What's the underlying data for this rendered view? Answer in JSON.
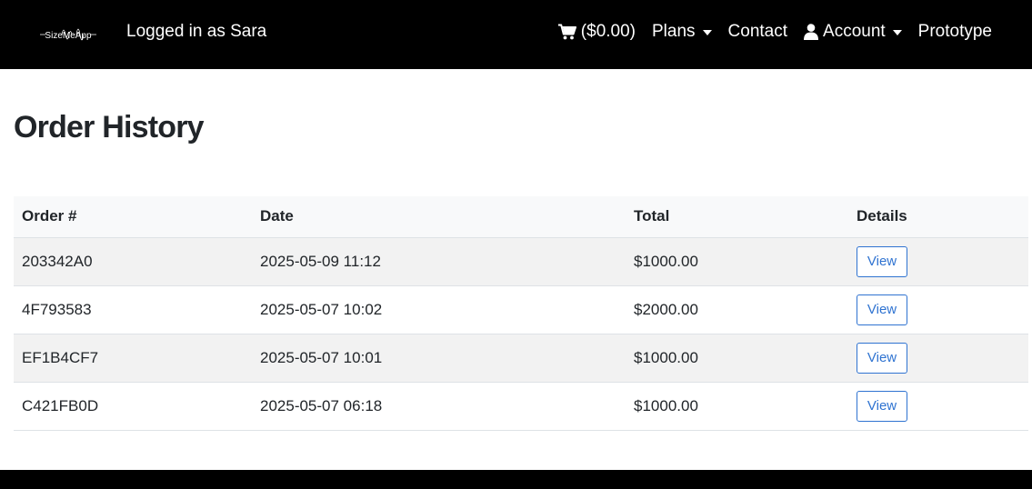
{
  "navbar": {
    "logo_text": "SizeMeApp",
    "logged_in": "Logged in as Sara",
    "cart_label": "($0.00)",
    "plans_label": "Plans",
    "contact_label": "Contact",
    "account_label": "Account",
    "prototype_label": "Prototype",
    "icons": [
      "cart-icon",
      "user-icon",
      "chevron-down-icon"
    ]
  },
  "page": {
    "title": "Order History"
  },
  "table": {
    "headers": [
      "Order #",
      "Date",
      "Total",
      "Details"
    ],
    "rows": [
      {
        "order": "203342A0",
        "date": "2025-05-09 11:12",
        "total": "$1000.00",
        "details": "View"
      },
      {
        "order": "4F793583",
        "date": "2025-05-07 10:02",
        "total": "$2000.00",
        "details": "View"
      },
      {
        "order": "EF1B4CF7",
        "date": "2025-05-07 10:01",
        "total": "$1000.00",
        "details": "View"
      },
      {
        "order": "C421FB0D",
        "date": "2025-05-07 06:18",
        "total": "$1000.00",
        "details": "View"
      }
    ]
  },
  "colors": {
    "navbar_bg": "#000000",
    "accent": "#2f73d1",
    "stripe": "#f2f2f2",
    "header_bg": "#f8f9fa"
  }
}
